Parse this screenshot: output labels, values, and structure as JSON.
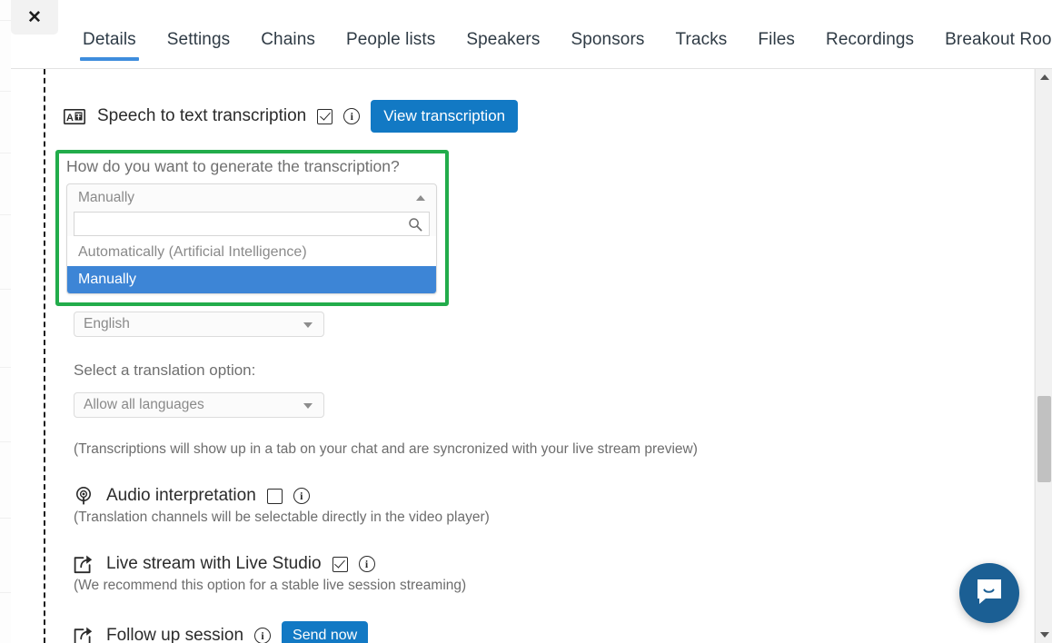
{
  "window": {
    "close_label": "✕"
  },
  "tabs": [
    {
      "label": "Details",
      "active": true
    },
    {
      "label": "Settings",
      "active": false
    },
    {
      "label": "Chains",
      "active": false
    },
    {
      "label": "People lists",
      "active": false
    },
    {
      "label": "Speakers",
      "active": false
    },
    {
      "label": "Sponsors",
      "active": false
    },
    {
      "label": "Tracks",
      "active": false
    },
    {
      "label": "Files",
      "active": false
    },
    {
      "label": "Recordings",
      "active": false
    },
    {
      "label": "Breakout Rooms",
      "active": false
    }
  ],
  "speech_to_text": {
    "icon": "translate-icon",
    "label": "Speech to text transcription",
    "checked": true,
    "info": "i",
    "button_label": "View transcription"
  },
  "transcription_method": {
    "question": "How do you want to generate the transcription?",
    "selected_value": "Manually",
    "search_value": "",
    "search_placeholder": "",
    "options": [
      {
        "label": "Automatically (Artificial Intelligence)",
        "selected": false
      },
      {
        "label": "Manually",
        "selected": true
      }
    ],
    "highlight_color": "#22ac4b"
  },
  "transcription_language": {
    "selected_value": "English"
  },
  "translation_option": {
    "label": "Select a translation option:",
    "selected_value": "Allow all languages"
  },
  "transcription_note": "(Transcriptions will show up in a tab on your chat and are syncronized with your live stream preview)",
  "audio_interpretation": {
    "icon": "microphone-broadcast-icon",
    "label": "Audio interpretation",
    "checked": false,
    "info": "i",
    "note": "(Translation channels will be selectable directly in the video player)"
  },
  "live_studio": {
    "icon": "share-stream-icon",
    "label": "Live stream with Live Studio",
    "checked": true,
    "info": "i",
    "note": "(We recommend this option for a stable live session streaming)"
  },
  "follow_up": {
    "icon": "share-stream-icon",
    "label": "Follow up session",
    "info": "i",
    "button_label": "Send now"
  },
  "intercom": {
    "icon": "chat-bubble-icon"
  },
  "scrollbar": {
    "up_icon": "caret-up-icon",
    "down_icon": "caret-down-icon"
  },
  "colors": {
    "accent_blue": "#1279c4",
    "tab_underline": "#3e8ddd",
    "option_selected": "#3d85d6",
    "highlight_green": "#22ac4b",
    "intercom_blue": "#1b5f94"
  }
}
